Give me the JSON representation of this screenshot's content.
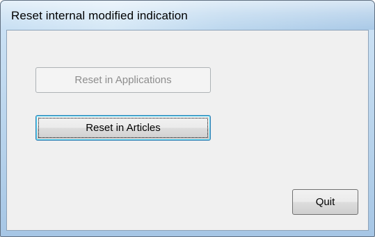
{
  "window": {
    "title": "Reset internal modified indication"
  },
  "buttons": {
    "reset_applications": "Reset in Applications",
    "reset_articles": "Reset in Articles",
    "quit": "Quit"
  },
  "state": {
    "reset_applications_enabled": false,
    "focused_button": "reset_articles"
  },
  "colors": {
    "client_background": "#f0f0f0",
    "title_gradient_light": "#d6e8f6",
    "title_gradient_dark": "#a9c9e7",
    "disabled_text": "#8d8d8d",
    "focus_border": "#3c7fb1"
  }
}
